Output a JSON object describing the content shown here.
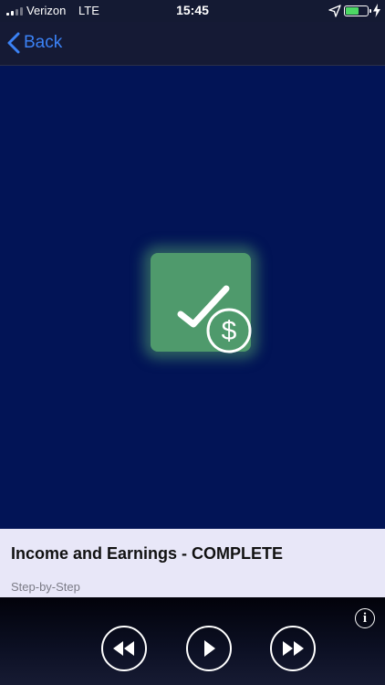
{
  "status_bar": {
    "carrier": "Verizon",
    "network": "LTE",
    "time": "15:45",
    "battery_level": 0.6,
    "signal_bars": 2
  },
  "nav": {
    "back_label": "Back"
  },
  "track": {
    "title": "Income and Earnings - COMPLETE",
    "subtitle": "Step-by-Step"
  },
  "controls": {
    "info_symbol": "i"
  },
  "colors": {
    "accent": "#3b82f6",
    "artwork_background": "#021456",
    "artwork_tile": "#4f9a6c",
    "info_panel": "#e8e7f8",
    "battery": "#4cd964"
  },
  "icons": {
    "artwork": "checkmark-dollar-icon",
    "rewind": "rewind-icon",
    "play": "play-icon",
    "forward": "fast-forward-icon",
    "info": "info-icon",
    "back": "chevron-left-icon"
  }
}
